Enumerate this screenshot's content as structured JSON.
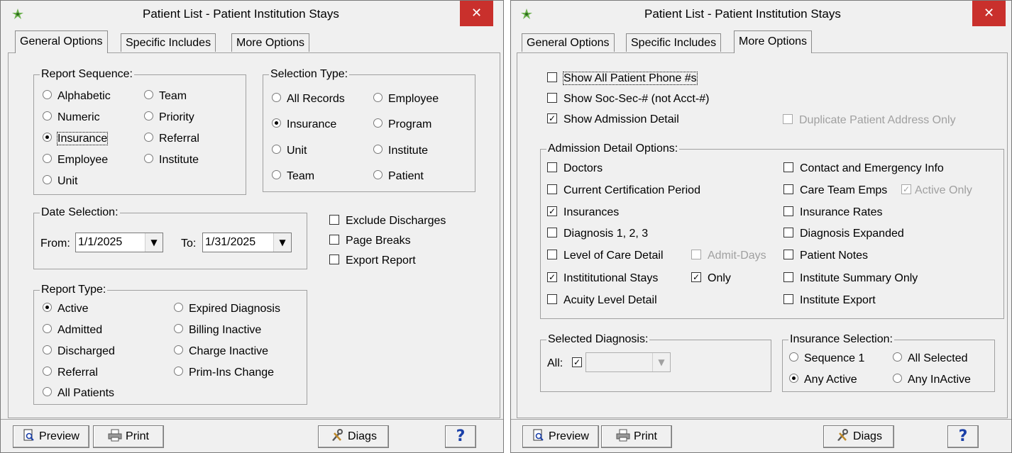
{
  "left_window": {
    "title": "Patient List - Patient Institution Stays",
    "close_label": "✕",
    "tabs": [
      {
        "label": "General Options"
      },
      {
        "label": "Specific Includes"
      },
      {
        "label": "More Options"
      }
    ],
    "report_sequence": {
      "title": "Report Sequence:",
      "options": [
        "Alphabetic",
        "Numeric",
        "Insurance",
        "Employee",
        "Unit",
        "Team",
        "Priority",
        "Referral",
        "Institute"
      ],
      "selected": "Insurance"
    },
    "selection_type": {
      "title": "Selection Type:",
      "options": [
        "All Records",
        "Insurance",
        "Unit",
        "Team",
        "Employee",
        "Program",
        "Institute",
        "Patient"
      ],
      "selected": "Insurance"
    },
    "date_selection": {
      "title": "Date Selection:",
      "from_label": "From:",
      "from_value": "1/1/2025",
      "to_label": "To:",
      "to_value": "1/31/2025"
    },
    "checkboxes": [
      {
        "label": "Exclude Discharges",
        "checked": false
      },
      {
        "label": "Page Breaks",
        "checked": false
      },
      {
        "label": "Export Report",
        "checked": false
      }
    ],
    "report_type": {
      "title": "Report Type:",
      "options": [
        "Active",
        "Admitted",
        "Discharged",
        "Referral",
        "All Patients",
        "Expired Diagnosis",
        "Billing Inactive",
        "Charge Inactive",
        "Prim-Ins Change"
      ],
      "selected": "Active"
    },
    "toolbar": {
      "preview": "Preview",
      "print": "Print",
      "diags": "Diags",
      "help": "?"
    }
  },
  "right_window": {
    "title": "Patient List - Patient Institution Stays",
    "close_label": "✕",
    "tabs": [
      {
        "label": "General Options"
      },
      {
        "label": "Specific Includes"
      },
      {
        "label": "More Options"
      }
    ],
    "top_checks": [
      {
        "label": "Show All Patient Phone #s",
        "checked": false
      },
      {
        "label": "Show Soc-Sec-# (not Acct-#)",
        "checked": false
      },
      {
        "label": "Show Admission Detail",
        "checked": true
      },
      {
        "label": "Duplicate Patient Address Only",
        "checked": false,
        "disabled": true
      }
    ],
    "admission_detail": {
      "title": "Admission Detail Options:",
      "left": [
        {
          "label": "Doctors",
          "checked": false
        },
        {
          "label": "Current Certification Period",
          "checked": false
        },
        {
          "label": "Insurances",
          "checked": true
        },
        {
          "label": "Diagnosis 1, 2, 3",
          "checked": false
        },
        {
          "label": "Level of Care Detail",
          "checked": false
        },
        {
          "label": "Instititutional Stays",
          "checked": true
        },
        {
          "label": "Acuity Level Detail",
          "checked": false
        }
      ],
      "admit_days": {
        "label": "Admit-Days",
        "checked": false
      },
      "only": {
        "label": "Only",
        "checked": true
      },
      "right": [
        {
          "label": "Contact and Emergency Info",
          "checked": false
        },
        {
          "label": "Care Team Emps",
          "checked": false
        },
        {
          "label": "Insurance Rates",
          "checked": false
        },
        {
          "label": "Diagnosis Expanded",
          "checked": false
        },
        {
          "label": "Patient Notes",
          "checked": false
        },
        {
          "label": "Institute Summary Only",
          "checked": false
        },
        {
          "label": "Institute Export",
          "checked": false
        }
      ],
      "active_only": {
        "label": "Active Only",
        "checked": true
      }
    },
    "selected_diagnosis": {
      "title": "Selected Diagnosis:",
      "all_label": "All:",
      "all_checked": true
    },
    "insurance_selection": {
      "title": "Insurance Selection:",
      "options": [
        "Sequence 1",
        "All Selected",
        "Any Active",
        "Any InActive"
      ],
      "selected": "Any Active"
    },
    "toolbar": {
      "preview": "Preview",
      "print": "Print",
      "diags": "Diags",
      "help": "?"
    }
  }
}
